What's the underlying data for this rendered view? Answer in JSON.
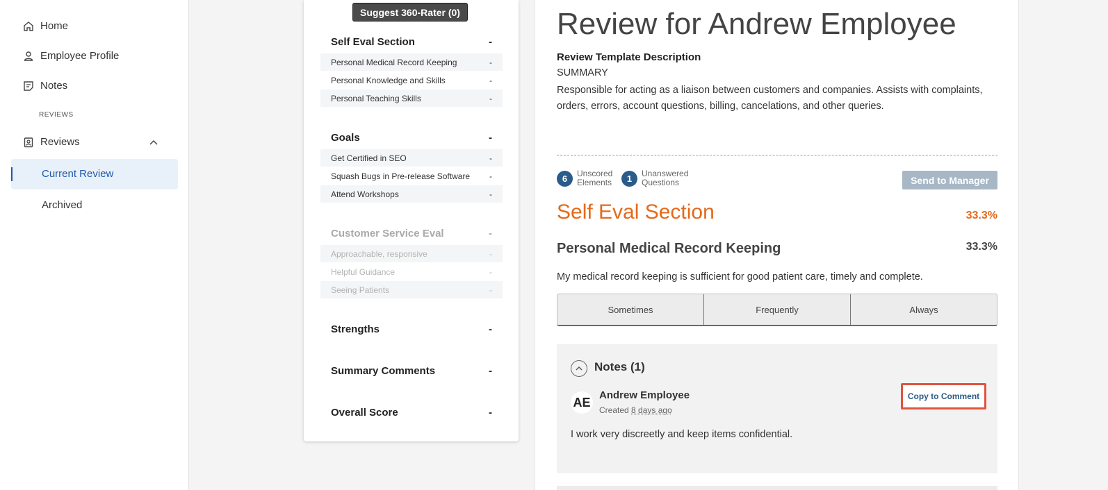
{
  "nav": {
    "home": "Home",
    "employee_profile": "Employee Profile",
    "notes": "Notes",
    "section_label": "REVIEWS",
    "reviews": "Reviews",
    "current_review": "Current Review",
    "archived": "Archived"
  },
  "outline": {
    "suggest_button": "Suggest 360-Rater (0)",
    "sections": [
      {
        "title": "Self Eval Section",
        "score": "-",
        "items": [
          {
            "label": "Personal Medical Record Keeping",
            "score": "-"
          },
          {
            "label": "Personal Knowledge and Skills",
            "score": "-"
          },
          {
            "label": "Personal Teaching Skills",
            "score": "-"
          }
        ]
      },
      {
        "title": "Goals",
        "score": "-",
        "items": [
          {
            "label": "Get Certified in SEO",
            "score": "-"
          },
          {
            "label": "Squash Bugs in Pre-release Software",
            "score": "-"
          },
          {
            "label": "Attend Workshops",
            "score": "-"
          }
        ]
      },
      {
        "title": "Customer Service Eval",
        "score": "-",
        "items": [
          {
            "label": "Approachable, responsive",
            "score": "-"
          },
          {
            "label": "Helpful Guidance",
            "score": "-"
          },
          {
            "label": "Seeing Patients",
            "score": "-"
          }
        ]
      },
      {
        "title": "Strengths",
        "score": "-"
      },
      {
        "title": "Summary Comments",
        "score": "-"
      },
      {
        "title": "Overall Score",
        "score": "-"
      }
    ]
  },
  "review": {
    "title": "Review for Andrew Employee",
    "template_label": "Review Template Description",
    "summary_heading": "SUMMARY",
    "description": "Responsible for acting as a liaison between customers and companies. Assists with complaints, orders, errors, account questions, billing, cancelations, and other queries.",
    "unscored_count": "6",
    "unscored_line1": "Unscored",
    "unscored_line2": "Elements",
    "unanswered_count": "1",
    "unanswered_line1": "Unanswered",
    "unanswered_line2": "Questions",
    "send_button": "Send to Manager",
    "section_title": "Self Eval Section",
    "section_pct": "33.3%",
    "question_title": "Personal Medical Record Keeping",
    "question_pct": "33.3%",
    "question_text": "My medical record keeping is sufficient for good patient care, timely and complete.",
    "choices": [
      "Sometimes",
      "Frequently",
      "Always"
    ],
    "notes": {
      "title": "Notes (1)",
      "avatar_initials": "AE",
      "author": "Andrew Employee",
      "created_prefix": "Created",
      "created_when": "8 days ago",
      "copy_button": "Copy to Comment",
      "body": "I work very discreetly and keep items confidential."
    }
  },
  "colors": {
    "accent_orange": "#e46a1a",
    "badge_blue": "#2b5b8a",
    "nav_active": "#1e5aa8",
    "highlight_red": "#e0533f"
  }
}
